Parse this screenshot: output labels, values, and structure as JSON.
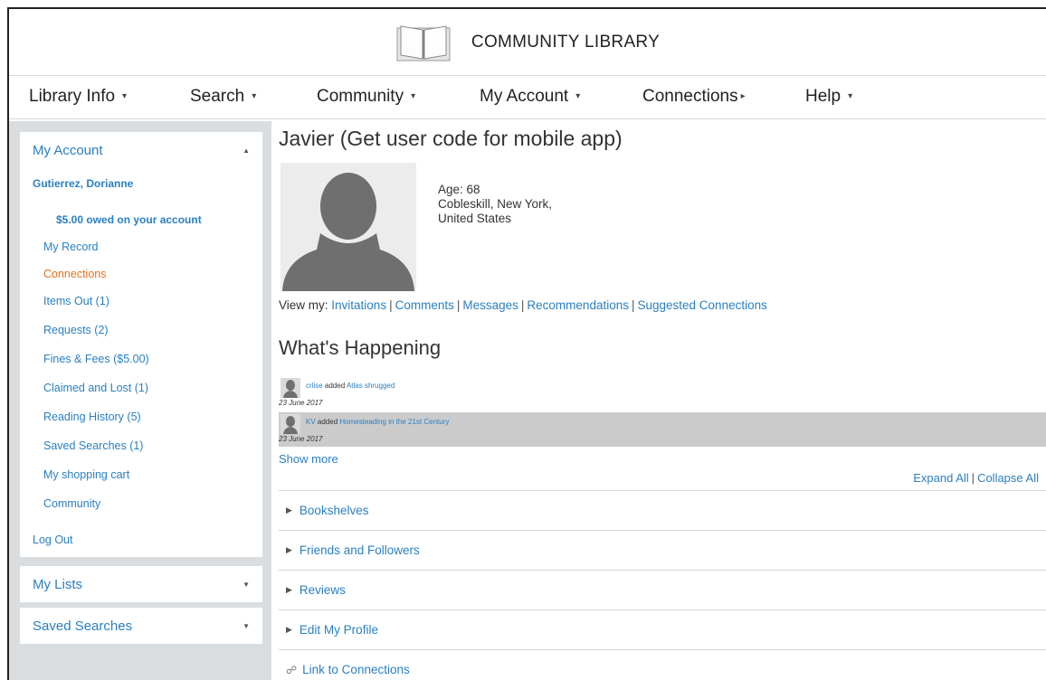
{
  "header": {
    "title": "COMMUNITY LIBRARY",
    "logo_icon": "open-book-icon"
  },
  "nav": {
    "items": [
      {
        "label": "Library Info",
        "caret": "▾"
      },
      {
        "label": "Search",
        "caret": "▾"
      },
      {
        "label": "Community",
        "caret": "▾"
      },
      {
        "label": "My Account",
        "caret": "▾"
      },
      {
        "label": "Connections",
        "caret": "▸"
      },
      {
        "label": "Help",
        "caret": "▾"
      }
    ]
  },
  "sidebar": {
    "account_panel": {
      "title": "My Account",
      "toggle": "▲",
      "user_name": "Gutierrez, Dorianne",
      "owed": "$5.00 owed on your account",
      "links": [
        {
          "label": "My Record",
          "active": false
        },
        {
          "label": "Connections",
          "active": true
        },
        {
          "label": "Items Out (1)",
          "active": false
        },
        {
          "label": "Requests (2)",
          "active": false
        },
        {
          "label": "Fines & Fees ($5.00)",
          "active": false
        },
        {
          "label": "Claimed and Lost (1)",
          "active": false
        },
        {
          "label": "Reading History (5)",
          "active": false
        },
        {
          "label": "Saved Searches (1)",
          "active": false
        },
        {
          "label": "My shopping cart",
          "active": false
        },
        {
          "label": "Community",
          "active": false
        }
      ],
      "logout": "Log Out"
    },
    "lists_panel": {
      "title": "My Lists",
      "toggle": "▼"
    },
    "saved_panel": {
      "title": "Saved Searches",
      "toggle": "▼"
    }
  },
  "profile": {
    "name": "Javier (Get user code for mobile app)",
    "age": "Age: 68",
    "location_line1": "Cobleskill, New York,",
    "location_line2": "United States"
  },
  "view_my": {
    "prefix": "View my:",
    "links": [
      "Invitations",
      "Comments",
      "Messages",
      "Recommendations",
      "Suggested Connections"
    ]
  },
  "happening": {
    "title": "What's Happening",
    "items": [
      {
        "user": "crlise",
        "action": "added",
        "item": "Atlas shrugged",
        "date": "23 June 2017"
      },
      {
        "user": "KV",
        "action": "added",
        "item": "Homesteading in the 21st Century",
        "date": "23 June 2017"
      }
    ],
    "show_more": "Show more"
  },
  "expand_all": "Expand All",
  "collapse_all": "Collapse All",
  "sections": [
    "Bookshelves",
    "Friends and Followers",
    "Reviews",
    "Edit My Profile"
  ],
  "section_caret": "▶",
  "link_connections": {
    "label": "Link to Connections",
    "icon": "link-icon"
  },
  "colors": {
    "link": "#2a7fc1",
    "active": "#e8701f",
    "sidebar_bg": "#d9dde0",
    "feed_alt": "#cbcbcb"
  }
}
